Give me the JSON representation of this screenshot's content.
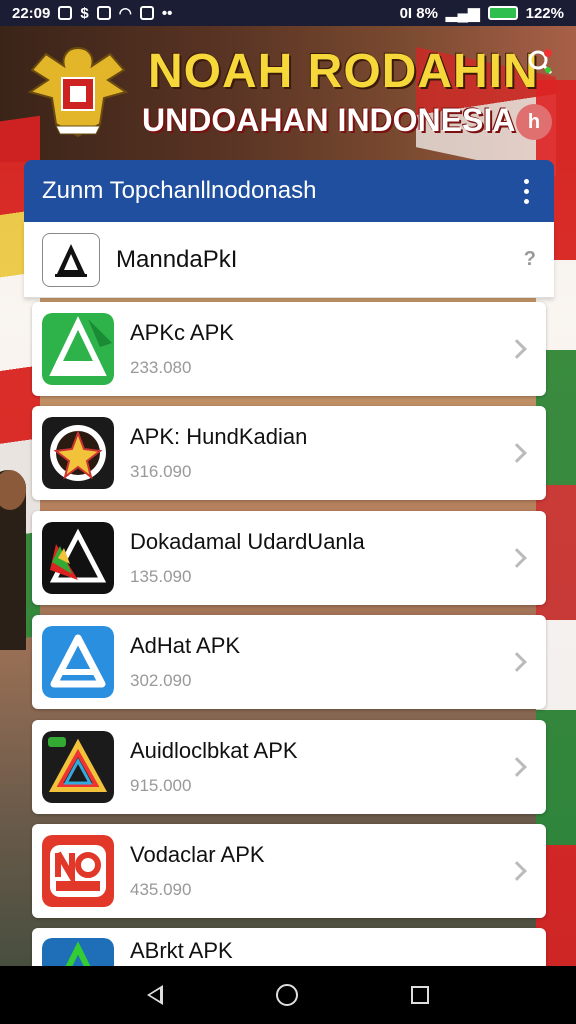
{
  "status_bar": {
    "time": "22:09",
    "right_text": "0I 8%",
    "battery": "122%"
  },
  "header": {
    "title": "NOAH RODAHIN",
    "subtitle": "UNDOAHAN INDONESIA",
    "badge": "h"
  },
  "panel": {
    "appbar_title": "Zunm  Topchanllnodonash",
    "source": {
      "name": "ManndaPkI",
      "help": "?"
    }
  },
  "apps": [
    {
      "name": "APKc APK",
      "size": "233.080",
      "icon": "green-triangle-icon",
      "color": "#2db34a"
    },
    {
      "name": "APK: HundKadian",
      "size": "316.090",
      "icon": "star-emblem-icon",
      "color": "#1a1a1a"
    },
    {
      "name": "Dokadamal UdardUanla",
      "size": "135.090",
      "icon": "triangle-logo-icon",
      "color": "#111111"
    },
    {
      "name": "AdHat APK",
      "size": "302.090",
      "icon": "blue-a-icon",
      "color": "#2b8fe0"
    },
    {
      "name": "Auidloclbkat APK",
      "size": "915.000",
      "icon": "rainbow-triangle-icon",
      "color": "#1b1b1b"
    },
    {
      "name": "Vodaclar APK",
      "size": "435.090",
      "icon": "red-badge-icon",
      "color": "#e2382a"
    },
    {
      "name": "ABrkt APK",
      "size": "",
      "icon": "blue-green-icon",
      "color": "#1e6fb8"
    }
  ],
  "nav": {
    "back_icon": "back-icon",
    "home_icon": "home-icon",
    "recent_icon": "recents-icon"
  }
}
